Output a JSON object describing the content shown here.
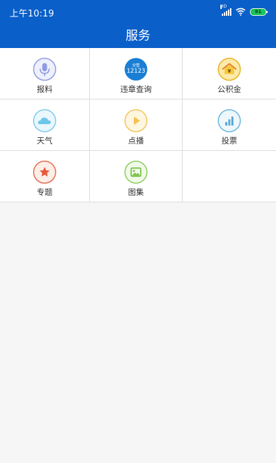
{
  "status_bar": {
    "time": "上午10:19",
    "signal_label": "HD",
    "battery": "91"
  },
  "header": {
    "title": "服务"
  },
  "services": [
    {
      "label": "报料",
      "icon": "microphone-icon"
    },
    {
      "label": "违章查询",
      "icon": "traffic-12123-icon",
      "icon_text_top": "交管",
      "icon_text_main": "12123"
    },
    {
      "label": "公积金",
      "icon": "house-yuan-icon"
    },
    {
      "label": "天气",
      "icon": "cloud-icon"
    },
    {
      "label": "点播",
      "icon": "play-icon"
    },
    {
      "label": "投票",
      "icon": "bar-chart-icon"
    },
    {
      "label": "专题",
      "icon": "star-icon"
    },
    {
      "label": "图集",
      "icon": "image-icon"
    }
  ],
  "colors": {
    "header_bg": "#0a5fc9",
    "page_bg": "#f6f6f6",
    "grid_line": "#dcdcdc",
    "text": "#333333"
  }
}
